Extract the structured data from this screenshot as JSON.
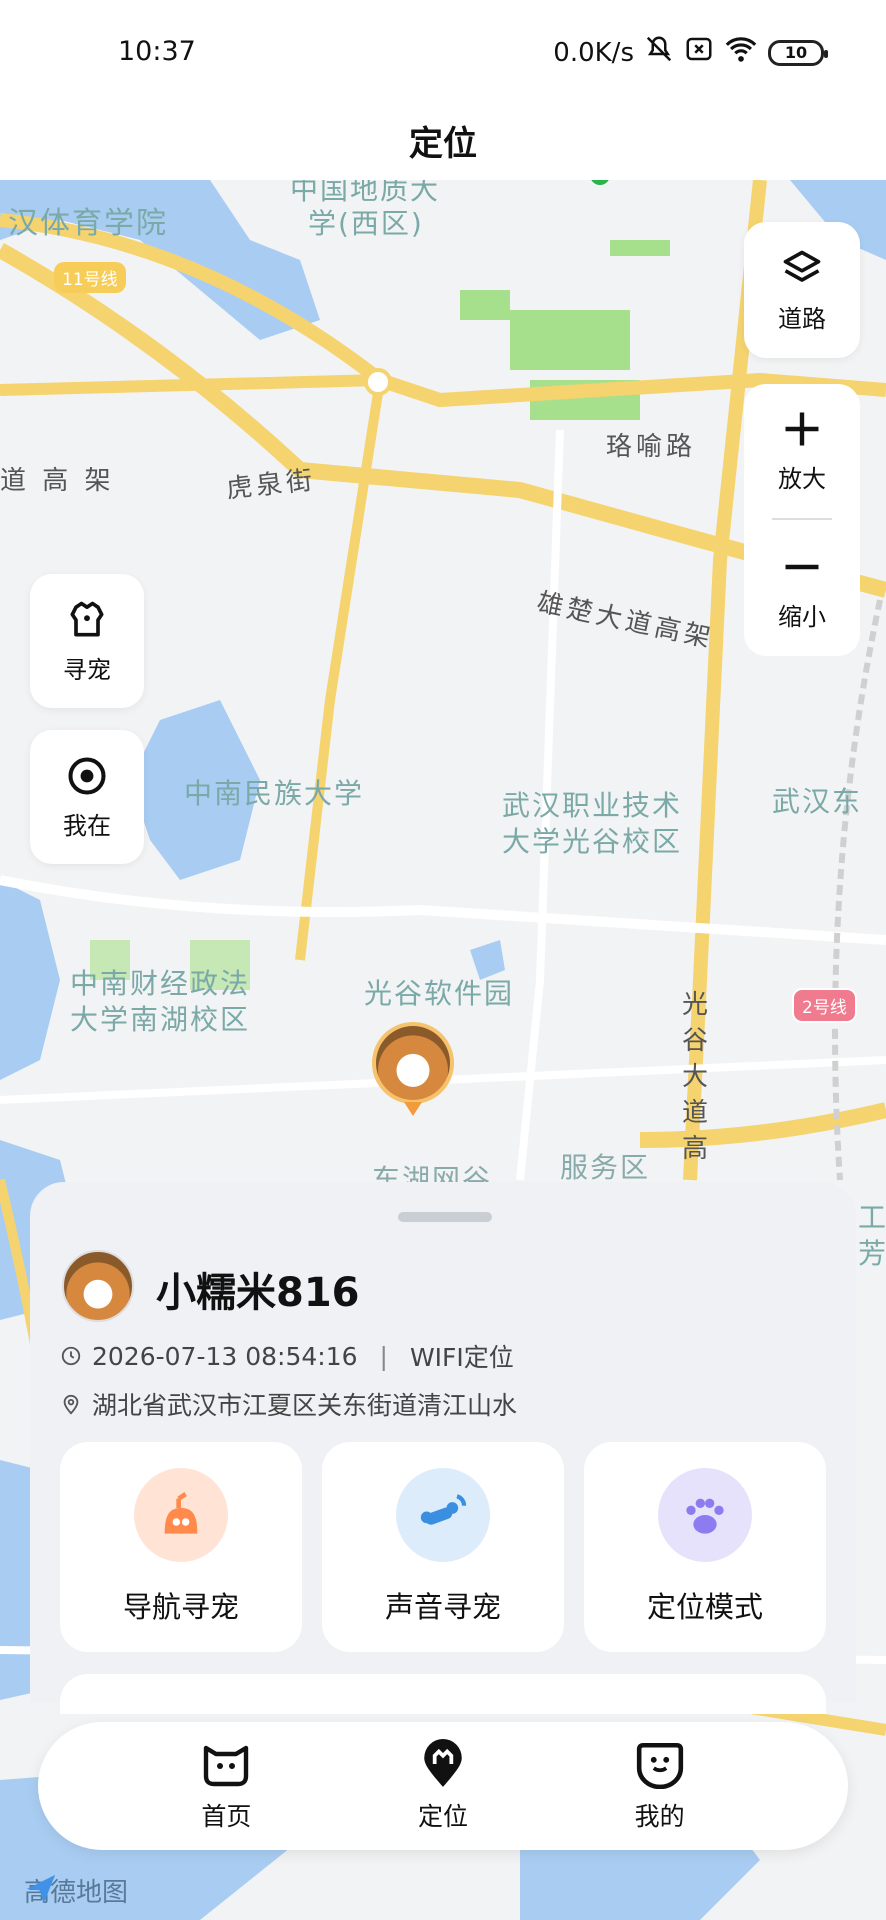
{
  "status_bar": {
    "time": "10:37",
    "speed": "0.0K/s",
    "battery": "10"
  },
  "header": {
    "title": "定位"
  },
  "map": {
    "labels": [
      "汉体育学院",
      "中国地质大",
      "学(西区)",
      "中南民族大学",
      "武汉职业技术",
      "大学光谷校区",
      "武汉东",
      "中南财经政法",
      "大学南湖校区",
      "光谷软件园",
      "东湖网谷",
      "服务区",
      "工",
      "芳"
    ],
    "roads": [
      "道 高 架",
      "虎泉街",
      "珞喻路",
      "雄楚大道高架",
      "光",
      "谷",
      "大",
      "道",
      "高"
    ],
    "line_badges": [
      "11号线",
      "2号线"
    ],
    "provider": "高德地图"
  },
  "map_controls": {
    "layer_label": "道路",
    "zoom_in_label": "放大",
    "zoom_out_label": "缩小",
    "find_pet_label": "寻宠",
    "my_location_label": "我在"
  },
  "pet": {
    "name": "小糯米816",
    "datetime": "2026-07-13 08:54:16",
    "separator": "|",
    "location_type": "WIFI定位",
    "address": "湖北省武汉市江夏区关东街道清江山水"
  },
  "actions": [
    {
      "label": "导航寻宠",
      "icon": "navigation-pet-icon",
      "color": "#ff8a4c"
    },
    {
      "label": "声音寻宠",
      "icon": "sound-pet-icon",
      "color": "#3b8fe0"
    },
    {
      "label": "定位模式",
      "icon": "paw-icon",
      "color": "#8c7cf0"
    }
  ],
  "tabs": [
    {
      "label": "首页",
      "icon": "home-cat-icon"
    },
    {
      "label": "定位",
      "icon": "location-pin-icon"
    },
    {
      "label": "我的",
      "icon": "profile-face-icon"
    }
  ]
}
